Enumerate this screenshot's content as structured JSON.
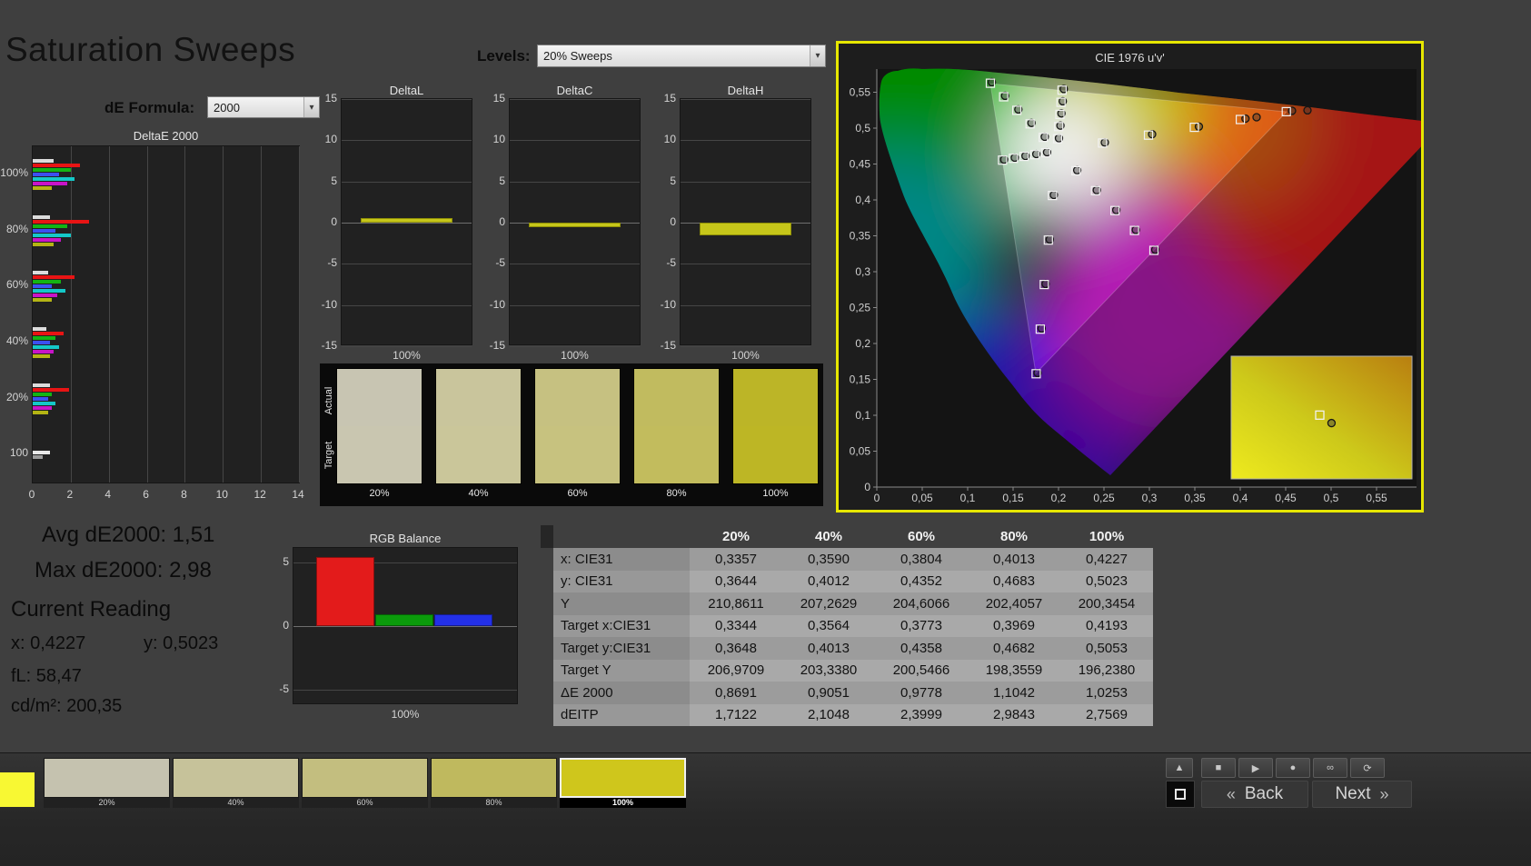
{
  "page": {
    "title": "Saturation Sweeps"
  },
  "controls": {
    "de_formula_label": "dE Formula:",
    "de_formula_value": "2000",
    "levels_label": "Levels:",
    "levels_value": "20% Sweeps",
    "dropdown_arrow": "▾"
  },
  "de_chart": {
    "title": "DeltaE 2000",
    "x_ticks": [
      "0",
      "2",
      "4",
      "6",
      "8",
      "10",
      "12",
      "14"
    ],
    "x_max": 14,
    "y_group_labels": [
      "100%",
      "80%",
      "60%",
      "40%",
      "20%",
      "100"
    ],
    "groups": [
      {
        "label": "100%",
        "bars": [
          [
            "#dcdcdc",
            1.1
          ],
          [
            "#e81414",
            2.5
          ],
          [
            "#14b414",
            2.0
          ],
          [
            "#3c50f0",
            1.4
          ],
          [
            "#14c8c8",
            2.2
          ],
          [
            "#c814c8",
            1.8
          ],
          [
            "#b4b414",
            1.0
          ]
        ]
      },
      {
        "label": "80%",
        "bars": [
          [
            "#dcdcdc",
            0.9
          ],
          [
            "#e81414",
            2.98
          ],
          [
            "#14b414",
            1.8
          ],
          [
            "#3c50f0",
            1.2
          ],
          [
            "#14c8c8",
            2.0
          ],
          [
            "#c814c8",
            1.5
          ],
          [
            "#b4b414",
            1.1
          ]
        ]
      },
      {
        "label": "60%",
        "bars": [
          [
            "#dcdcdc",
            0.8
          ],
          [
            "#e81414",
            2.2
          ],
          [
            "#14b414",
            1.5
          ],
          [
            "#3c50f0",
            1.0
          ],
          [
            "#14c8c8",
            1.7
          ],
          [
            "#c814c8",
            1.3
          ],
          [
            "#b4b414",
            1.0
          ]
        ]
      },
      {
        "label": "40%",
        "bars": [
          [
            "#dcdcdc",
            0.7
          ],
          [
            "#e81414",
            1.6
          ],
          [
            "#14b414",
            1.2
          ],
          [
            "#3c50f0",
            0.9
          ],
          [
            "#14c8c8",
            1.4
          ],
          [
            "#c814c8",
            1.1
          ],
          [
            "#b4b414",
            0.9
          ]
        ]
      },
      {
        "label": "20%",
        "bars": [
          [
            "#dcdcdc",
            0.9
          ],
          [
            "#e81414",
            1.9
          ],
          [
            "#14b414",
            1.0
          ],
          [
            "#3c50f0",
            0.8
          ],
          [
            "#14c8c8",
            1.2
          ],
          [
            "#c814c8",
            1.0
          ],
          [
            "#b4b414",
            0.8
          ]
        ]
      },
      {
        "label": "100",
        "bars": [
          [
            "#e8e8e8",
            0.9
          ],
          [
            "#9a9a9a",
            0.5
          ]
        ]
      }
    ]
  },
  "delta_y_ticks": [
    "15",
    "10",
    "5",
    "0",
    "-5",
    "-10",
    "-15"
  ],
  "delta_y_max": 15,
  "delta_charts": [
    {
      "title": "DeltaL",
      "xlabel": "100%",
      "value": 0.6
    },
    {
      "title": "DeltaC",
      "xlabel": "100%",
      "value": -0.2
    },
    {
      "title": "DeltaH",
      "xlabel": "100%",
      "value": -1.5
    }
  ],
  "swatch_panel": {
    "row_labels": [
      "Actual",
      "Target"
    ],
    "swatches": [
      {
        "label": "20%",
        "actual": "#c8c5b2",
        "target": "#c9c6b0"
      },
      {
        "label": "40%",
        "actual": "#c9c59c",
        "target": "#cac69a"
      },
      {
        "label": "60%",
        "actual": "#c6c181",
        "target": "#c7c27f"
      },
      {
        "label": "80%",
        "actual": "#c1bb5f",
        "target": "#c2bc5d"
      },
      {
        "label": "100%",
        "actual": "#bcb527",
        "target": "#bdb625"
      }
    ]
  },
  "cie": {
    "title": "CIE 1976 u'v'",
    "x_ticks": [
      "0",
      "0,05",
      "0,1",
      "0,15",
      "0,2",
      "0,25",
      "0,3",
      "0,35",
      "0,4",
      "0,45",
      "0,5",
      "0,55"
    ],
    "y_ticks": [
      "0",
      "0,05",
      "0,1",
      "0,15",
      "0,2",
      "0,25",
      "0,3",
      "0,35",
      "0,4",
      "0,45",
      "0,5",
      "0,55"
    ],
    "tick_step": 0.05,
    "targets": [
      [
        0.199,
        0.4852
      ],
      [
        0.2002,
        0.5021
      ],
      [
        0.2015,
        0.5191
      ],
      [
        0.2027,
        0.536
      ],
      [
        0.2039,
        0.5529
      ],
      [
        0.2484,
        0.4792
      ],
      [
        0.299,
        0.4902
      ],
      [
        0.3495,
        0.5011
      ],
      [
        0.4001,
        0.512
      ],
      [
        0.4507,
        0.5229
      ],
      [
        0.1832,
        0.4871
      ],
      [
        0.1687,
        0.506
      ],
      [
        0.1541,
        0.5248
      ],
      [
        0.1396,
        0.5437
      ],
      [
        0.125,
        0.5625
      ],
      [
        0.1933,
        0.4062
      ],
      [
        0.1888,
        0.3441
      ],
      [
        0.1843,
        0.2821
      ],
      [
        0.1799,
        0.22
      ],
      [
        0.1754,
        0.1579
      ],
      [
        0.1859,
        0.4657
      ],
      [
        0.174,
        0.4631
      ],
      [
        0.1621,
        0.4606
      ],
      [
        0.1503,
        0.458
      ],
      [
        0.1384,
        0.4554
      ],
      [
        0.2192,
        0.4406
      ],
      [
        0.2407,
        0.4129
      ],
      [
        0.2621,
        0.3852
      ],
      [
        0.2836,
        0.3575
      ],
      [
        0.305,
        0.3298
      ]
    ],
    "measurements": [
      [
        0.2005,
        0.486
      ],
      [
        0.2021,
        0.5035
      ],
      [
        0.2032,
        0.5205
      ],
      [
        0.2047,
        0.5375
      ],
      [
        0.2058,
        0.5545
      ],
      [
        0.251,
        0.48
      ],
      [
        0.303,
        0.4915
      ],
      [
        0.3545,
        0.5022
      ],
      [
        0.4058,
        0.5133
      ],
      [
        0.457,
        0.5242
      ],
      [
        0.1849,
        0.488
      ],
      [
        0.1702,
        0.5072
      ],
      [
        0.1558,
        0.5261
      ],
      [
        0.1412,
        0.545
      ],
      [
        0.1266,
        0.564
      ],
      [
        0.1949,
        0.407
      ],
      [
        0.1903,
        0.345
      ],
      [
        0.1858,
        0.283
      ],
      [
        0.1814,
        0.221
      ],
      [
        0.1769,
        0.159
      ],
      [
        0.1874,
        0.4664
      ],
      [
        0.1756,
        0.4639
      ],
      [
        0.1637,
        0.4613
      ],
      [
        0.1519,
        0.4588
      ],
      [
        0.1401,
        0.4562
      ],
      [
        0.2206,
        0.4414
      ],
      [
        0.2421,
        0.4137
      ],
      [
        0.2636,
        0.386
      ],
      [
        0.2851,
        0.3583
      ],
      [
        0.3065,
        0.3306
      ],
      [
        0.418,
        0.5152
      ],
      [
        0.474,
        0.5248
      ]
    ],
    "inset_marker_target": [
      0.49,
      0.48
    ],
    "inset_marker_measured": [
      0.555,
      0.545
    ]
  },
  "stats": {
    "avg": "Avg dE2000: 1,51",
    "max": "Max dE2000: 2,98",
    "current_reading_label": "Current Reading",
    "x": "x: 0,4227",
    "y": "y: 0,5023",
    "fl": "fL: 58,47",
    "cd": "cd/m²: 200,35"
  },
  "rgb_balance": {
    "title": "RGB Balance",
    "xlabel": "100%",
    "y_ticks": [
      "5",
      "0",
      "-5"
    ],
    "bars": [
      [
        "#e31b1b",
        5.4
      ],
      [
        "#0b9b0b",
        0.9
      ],
      [
        "#2330e8",
        0.9
      ]
    ]
  },
  "table": {
    "columns": [
      "20%",
      "40%",
      "60%",
      "80%",
      "100%"
    ],
    "rows": [
      {
        "label": "x: CIE31",
        "values": [
          "0,3357",
          "0,3590",
          "0,3804",
          "0,4013",
          "0,4227"
        ]
      },
      {
        "label": "y: CIE31",
        "values": [
          "0,3644",
          "0,4012",
          "0,4352",
          "0,4683",
          "0,5023"
        ]
      },
      {
        "label": "Y",
        "values": [
          "210,8611",
          "207,2629",
          "204,6066",
          "202,4057",
          "200,3454"
        ]
      },
      {
        "label": "Target x:CIE31",
        "values": [
          "0,3344",
          "0,3564",
          "0,3773",
          "0,3969",
          "0,4193"
        ]
      },
      {
        "label": "Target y:CIE31",
        "values": [
          "0,3648",
          "0,4013",
          "0,4358",
          "0,4682",
          "0,5053"
        ]
      },
      {
        "label": "Target Y",
        "values": [
          "206,9709",
          "203,3380",
          "200,5466",
          "198,3559",
          "196,2380"
        ]
      },
      {
        "label": "ΔE 2000",
        "values": [
          "0,8691",
          "0,9051",
          "0,9778",
          "1,1042",
          "1,0253"
        ]
      },
      {
        "label": "dEITP",
        "values": [
          "1,7122",
          "2,1048",
          "2,3999",
          "2,9843",
          "2,7569"
        ]
      }
    ]
  },
  "bottom_bar": {
    "corner_color": "#f8f833",
    "swatches": [
      {
        "label": "20%",
        "color": "#c5c2af",
        "selected": false
      },
      {
        "label": "40%",
        "color": "#c6c29a",
        "selected": false
      },
      {
        "label": "60%",
        "color": "#c3be7f",
        "selected": false
      },
      {
        "label": "80%",
        "color": "#bfb95e",
        "selected": false
      },
      {
        "label": "100%",
        "color": "#cfc61c",
        "selected": true
      }
    ],
    "media_buttons": [
      {
        "name": "up-arrow-icon",
        "glyph": "▲"
      },
      {
        "name": "stop-icon",
        "glyph": "■"
      },
      {
        "name": "play-icon",
        "glyph": "▶"
      },
      {
        "name": "record-icon",
        "glyph": "●"
      },
      {
        "name": "loop-icon",
        "glyph": "∞"
      },
      {
        "name": "refresh-icon",
        "glyph": "⟳"
      }
    ],
    "back_chevrons": "«",
    "back_label": "Back",
    "next_label": "Next",
    "next_chevrons": "»"
  }
}
